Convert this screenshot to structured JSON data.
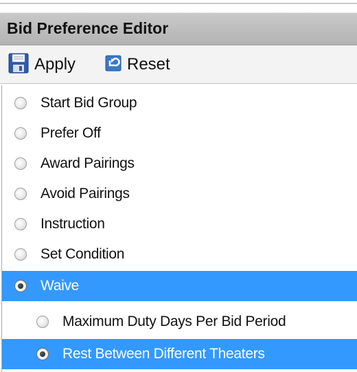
{
  "header": {
    "title": "Bid Preference Editor"
  },
  "toolbar": {
    "apply_label": "Apply",
    "reset_label": "Reset",
    "apply_icon": "save-icon",
    "reset_icon": "reset-icon"
  },
  "colors": {
    "selection": "#3399ff",
    "header_bg": "#bdbdbd",
    "toolbar_bg": "#f3f3f3"
  },
  "preferences": [
    {
      "label": "Start Bid Group",
      "checked": false,
      "selected": false,
      "level": 0
    },
    {
      "label": "Prefer Off",
      "checked": false,
      "selected": false,
      "level": 0
    },
    {
      "label": "Award Pairings",
      "checked": false,
      "selected": false,
      "level": 0
    },
    {
      "label": "Avoid Pairings",
      "checked": false,
      "selected": false,
      "level": 0
    },
    {
      "label": "Instruction",
      "checked": false,
      "selected": false,
      "level": 0
    },
    {
      "label": "Set Condition",
      "checked": false,
      "selected": false,
      "level": 0
    },
    {
      "label": "Waive",
      "checked": true,
      "selected": true,
      "level": 0
    },
    {
      "label": "Maximum Duty Days Per Bid Period",
      "checked": false,
      "selected": false,
      "level": 1
    },
    {
      "label": "Rest Between Different Theaters",
      "checked": true,
      "selected": true,
      "level": 1
    }
  ]
}
